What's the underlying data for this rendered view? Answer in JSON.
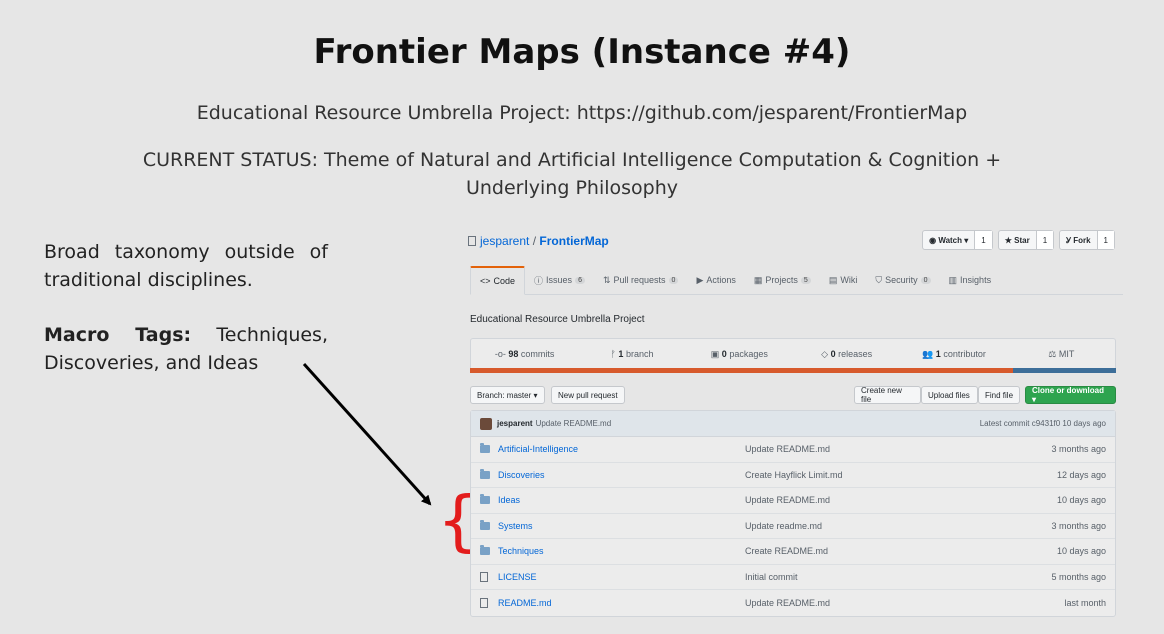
{
  "slide": {
    "title": "Frontier Maps (Instance #4)",
    "subtitle": "Educational Resource Umbrella Project:  https://github.com/jesparent/FrontierMap",
    "status_line1": "CURRENT STATUS: Theme of Natural and Artificial Intelligence Computation & Cognition +",
    "status_line2": "Underlying Philosophy",
    "left_para1": "Broad taxonomy outside of traditional disciplines.",
    "macro_label": "Macro Tags:",
    "macro_text": " Techniques, Discoveries, and Ideas",
    "brace": "{",
    "colors": {
      "brace": "#e31c1c",
      "arrow": "#000000"
    }
  },
  "github": {
    "owner": "jesparent",
    "separator": "/",
    "repo": "FrontierMap",
    "watch": {
      "label": "Watch ▾",
      "count": "1"
    },
    "star": {
      "label": "★ Star",
      "count": "1"
    },
    "fork": {
      "label": "Fork",
      "count": "1"
    },
    "tabs": [
      {
        "label": "Code",
        "icon": "code-icon",
        "count": ""
      },
      {
        "label": "Issues",
        "icon": "issue-icon",
        "count": "6"
      },
      {
        "label": "Pull requests",
        "icon": "pr-icon",
        "count": "0"
      },
      {
        "label": "Actions",
        "icon": "play-icon",
        "count": ""
      },
      {
        "label": "Projects",
        "icon": "project-icon",
        "count": "5"
      },
      {
        "label": "Wiki",
        "icon": "book-icon",
        "count": ""
      },
      {
        "label": "Security",
        "icon": "shield-icon",
        "count": "0"
      },
      {
        "label": "Insights",
        "icon": "graph-icon",
        "count": ""
      }
    ],
    "description": "Educational Resource Umbrella Project",
    "stats": {
      "commits": "98",
      "commits_label": "commits",
      "branch": "1",
      "branch_label": "branch",
      "packages": "0",
      "packages_label": "packages",
      "releases": "0",
      "releases_label": "releases",
      "contributors": "1",
      "contributors_label": "contributor",
      "license": "MIT"
    },
    "toolbar": {
      "branch": "Branch: master ▾",
      "new_pr": "New pull request",
      "create_file": "Create new file",
      "upload": "Upload files",
      "find": "Find file",
      "clone": "Clone or download ▾"
    },
    "commit": {
      "user": "jesparent",
      "message": "Update README.md",
      "latest": "Latest commit c9431f0 10 days ago"
    },
    "files": [
      {
        "type": "dir",
        "name": "Artificial-Intelligence",
        "message": "Update README.md",
        "age": "3 months ago"
      },
      {
        "type": "dir",
        "name": "Discoveries",
        "message": "Create Hayflick Limit.md",
        "age": "12 days ago"
      },
      {
        "type": "dir",
        "name": "Ideas",
        "message": "Update README.md",
        "age": "10 days ago"
      },
      {
        "type": "dir",
        "name": "Systems",
        "message": "Update readme.md",
        "age": "3 months ago"
      },
      {
        "type": "dir",
        "name": "Techniques",
        "message": "Create README.md",
        "age": "10 days ago"
      },
      {
        "type": "file",
        "name": "LICENSE",
        "message": "Initial commit",
        "age": "5 months ago"
      },
      {
        "type": "file",
        "name": "README.md",
        "message": "Update README.md",
        "age": "last month"
      }
    ]
  }
}
